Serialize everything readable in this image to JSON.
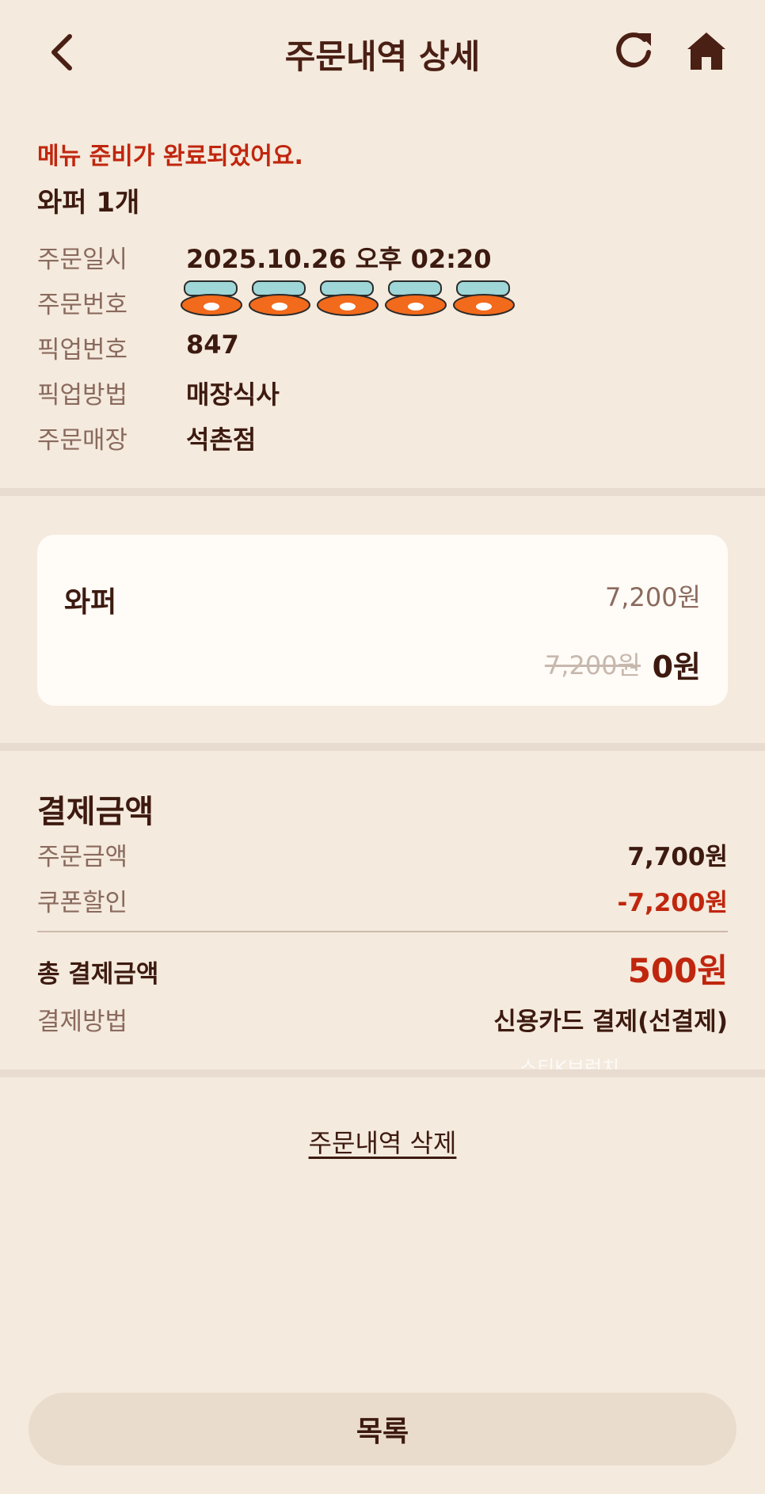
{
  "header": {
    "title": "주문내역 상세",
    "back_icon": "chevron-left-icon",
    "refresh_icon": "refresh-icon",
    "home_icon": "home-icon"
  },
  "order": {
    "status_message": "메뉴 준비가 완료되었어요.",
    "summary": "와퍼 1개",
    "info": [
      {
        "label": "주문일시",
        "value": "2025.10.26 오후 02:20"
      },
      {
        "label": "주문번호",
        "value": ""
      },
      {
        "label": "픽업번호",
        "value": "847"
      },
      {
        "label": "픽업방법",
        "value": "매장식사"
      },
      {
        "label": "주문매장",
        "value": "석촌점"
      }
    ]
  },
  "item": {
    "name": "와퍼",
    "price": "7,200원",
    "original_price": "7,200원",
    "final_price": "0원"
  },
  "payment": {
    "title": "결제금액",
    "order_amount_label": "주문금액",
    "order_amount": "7,700원",
    "coupon_label": "쿠폰할인",
    "coupon_amount": "-7,200원",
    "total_label": "총 결제금액",
    "total_amount": "500원",
    "method_label": "결제방법",
    "method": "신용카드 결제(선결제)"
  },
  "watermark": "스티K브런치",
  "actions": {
    "delete_label": "주문내역 삭제",
    "list_label": "목록"
  },
  "colors": {
    "background": "#f4eadd",
    "accent_red": "#c0260e",
    "text_dark": "#3d1a10",
    "text_muted": "#8a6a5e"
  }
}
